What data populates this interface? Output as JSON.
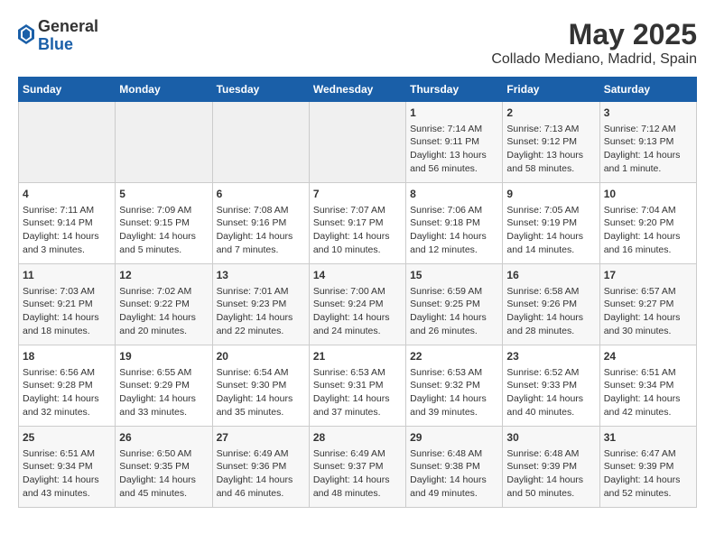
{
  "header": {
    "logo_general": "General",
    "logo_blue": "Blue",
    "title": "May 2025",
    "subtitle": "Collado Mediano, Madrid, Spain"
  },
  "calendar": {
    "columns": [
      "Sunday",
      "Monday",
      "Tuesday",
      "Wednesday",
      "Thursday",
      "Friday",
      "Saturday"
    ],
    "rows": [
      [
        {
          "day": "",
          "info": ""
        },
        {
          "day": "",
          "info": ""
        },
        {
          "day": "",
          "info": ""
        },
        {
          "day": "",
          "info": ""
        },
        {
          "day": "1",
          "info": "Sunrise: 7:14 AM\nSunset: 9:11 PM\nDaylight: 13 hours\nand 56 minutes."
        },
        {
          "day": "2",
          "info": "Sunrise: 7:13 AM\nSunset: 9:12 PM\nDaylight: 13 hours\nand 58 minutes."
        },
        {
          "day": "3",
          "info": "Sunrise: 7:12 AM\nSunset: 9:13 PM\nDaylight: 14 hours\nand 1 minute."
        }
      ],
      [
        {
          "day": "4",
          "info": "Sunrise: 7:11 AM\nSunset: 9:14 PM\nDaylight: 14 hours\nand 3 minutes."
        },
        {
          "day": "5",
          "info": "Sunrise: 7:09 AM\nSunset: 9:15 PM\nDaylight: 14 hours\nand 5 minutes."
        },
        {
          "day": "6",
          "info": "Sunrise: 7:08 AM\nSunset: 9:16 PM\nDaylight: 14 hours\nand 7 minutes."
        },
        {
          "day": "7",
          "info": "Sunrise: 7:07 AM\nSunset: 9:17 PM\nDaylight: 14 hours\nand 10 minutes."
        },
        {
          "day": "8",
          "info": "Sunrise: 7:06 AM\nSunset: 9:18 PM\nDaylight: 14 hours\nand 12 minutes."
        },
        {
          "day": "9",
          "info": "Sunrise: 7:05 AM\nSunset: 9:19 PM\nDaylight: 14 hours\nand 14 minutes."
        },
        {
          "day": "10",
          "info": "Sunrise: 7:04 AM\nSunset: 9:20 PM\nDaylight: 14 hours\nand 16 minutes."
        }
      ],
      [
        {
          "day": "11",
          "info": "Sunrise: 7:03 AM\nSunset: 9:21 PM\nDaylight: 14 hours\nand 18 minutes."
        },
        {
          "day": "12",
          "info": "Sunrise: 7:02 AM\nSunset: 9:22 PM\nDaylight: 14 hours\nand 20 minutes."
        },
        {
          "day": "13",
          "info": "Sunrise: 7:01 AM\nSunset: 9:23 PM\nDaylight: 14 hours\nand 22 minutes."
        },
        {
          "day": "14",
          "info": "Sunrise: 7:00 AM\nSunset: 9:24 PM\nDaylight: 14 hours\nand 24 minutes."
        },
        {
          "day": "15",
          "info": "Sunrise: 6:59 AM\nSunset: 9:25 PM\nDaylight: 14 hours\nand 26 minutes."
        },
        {
          "day": "16",
          "info": "Sunrise: 6:58 AM\nSunset: 9:26 PM\nDaylight: 14 hours\nand 28 minutes."
        },
        {
          "day": "17",
          "info": "Sunrise: 6:57 AM\nSunset: 9:27 PM\nDaylight: 14 hours\nand 30 minutes."
        }
      ],
      [
        {
          "day": "18",
          "info": "Sunrise: 6:56 AM\nSunset: 9:28 PM\nDaylight: 14 hours\nand 32 minutes."
        },
        {
          "day": "19",
          "info": "Sunrise: 6:55 AM\nSunset: 9:29 PM\nDaylight: 14 hours\nand 33 minutes."
        },
        {
          "day": "20",
          "info": "Sunrise: 6:54 AM\nSunset: 9:30 PM\nDaylight: 14 hours\nand 35 minutes."
        },
        {
          "day": "21",
          "info": "Sunrise: 6:53 AM\nSunset: 9:31 PM\nDaylight: 14 hours\nand 37 minutes."
        },
        {
          "day": "22",
          "info": "Sunrise: 6:53 AM\nSunset: 9:32 PM\nDaylight: 14 hours\nand 39 minutes."
        },
        {
          "day": "23",
          "info": "Sunrise: 6:52 AM\nSunset: 9:33 PM\nDaylight: 14 hours\nand 40 minutes."
        },
        {
          "day": "24",
          "info": "Sunrise: 6:51 AM\nSunset: 9:34 PM\nDaylight: 14 hours\nand 42 minutes."
        }
      ],
      [
        {
          "day": "25",
          "info": "Sunrise: 6:51 AM\nSunset: 9:34 PM\nDaylight: 14 hours\nand 43 minutes."
        },
        {
          "day": "26",
          "info": "Sunrise: 6:50 AM\nSunset: 9:35 PM\nDaylight: 14 hours\nand 45 minutes."
        },
        {
          "day": "27",
          "info": "Sunrise: 6:49 AM\nSunset: 9:36 PM\nDaylight: 14 hours\nand 46 minutes."
        },
        {
          "day": "28",
          "info": "Sunrise: 6:49 AM\nSunset: 9:37 PM\nDaylight: 14 hours\nand 48 minutes."
        },
        {
          "day": "29",
          "info": "Sunrise: 6:48 AM\nSunset: 9:38 PM\nDaylight: 14 hours\nand 49 minutes."
        },
        {
          "day": "30",
          "info": "Sunrise: 6:48 AM\nSunset: 9:39 PM\nDaylight: 14 hours\nand 50 minutes."
        },
        {
          "day": "31",
          "info": "Sunrise: 6:47 AM\nSunset: 9:39 PM\nDaylight: 14 hours\nand 52 minutes."
        }
      ]
    ]
  }
}
